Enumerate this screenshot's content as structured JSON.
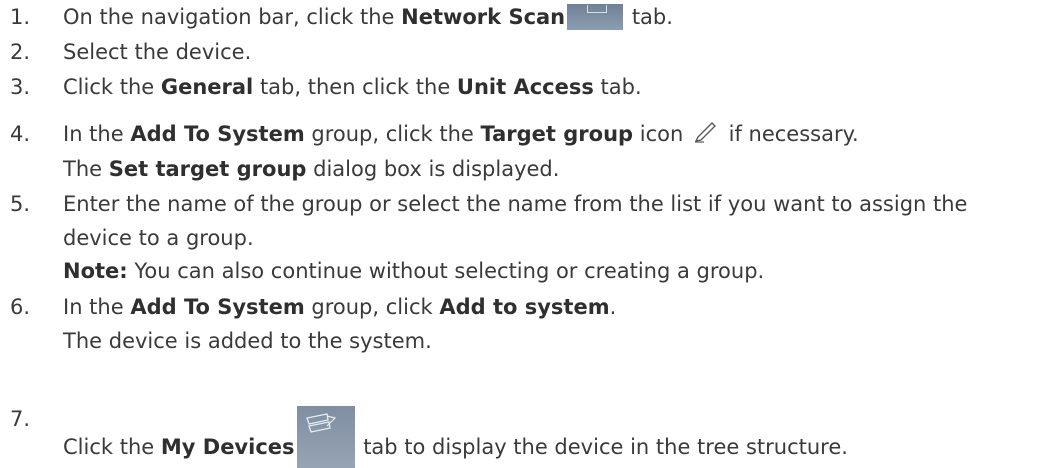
{
  "steps": [
    {
      "num": "1.",
      "a": "On the navigation bar, click the ",
      "b": "Network Scan",
      "c": " tab."
    },
    {
      "num": "2.",
      "a": "Select the device."
    },
    {
      "num": "3.",
      "a": "Click the ",
      "b": "General",
      "c": " tab, then click the ",
      "d": "Unit Access",
      "e": " tab."
    },
    {
      "num": "4.",
      "a": "In the ",
      "b": "Add To System",
      "c": " group, click the ",
      "d": "Target group",
      "e": " icon ",
      "f": " if necessary.",
      "sub": {
        "b": "Set target group",
        "c": " dialog box is displayed.",
        "a": "The "
      }
    },
    {
      "num": "5.",
      "a": "Enter the name of the group or select the name from the list if you want to assign the",
      "cont": "device to a group.",
      "note_label": "Note:",
      "note_text": " You can also continue without selecting or creating a group."
    },
    {
      "num": "6.",
      "a": "In the ",
      "b": "Add To System",
      "c": " group, click ",
      "d": "Add to system",
      "e": ".",
      "sub": "The device is added to the system."
    },
    {
      "num": "7.",
      "a": "Click the ",
      "b": "My Devices",
      "c": " tab to display the device in the tree structure."
    }
  ],
  "icons": {
    "network_scan": "network-scan-icon",
    "target_group": "pencil-icon",
    "my_devices": "camera-devices-icon",
    "accent": "#6f8197"
  }
}
